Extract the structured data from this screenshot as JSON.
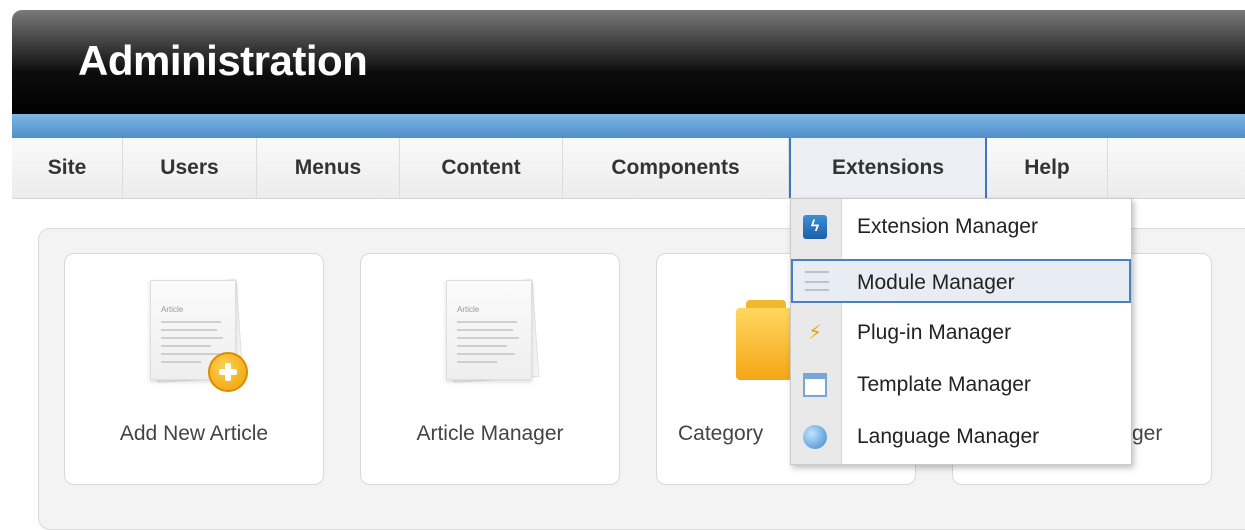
{
  "header": {
    "title": "Administration"
  },
  "menu": {
    "items": [
      {
        "label": "Site"
      },
      {
        "label": "Users"
      },
      {
        "label": "Menus"
      },
      {
        "label": "Content"
      },
      {
        "label": "Components"
      },
      {
        "label": "Extensions",
        "active": true
      },
      {
        "label": "Help"
      }
    ]
  },
  "cards": [
    {
      "label": "Add New Article",
      "icon": "add-article-icon"
    },
    {
      "label": "Article Manager",
      "icon": "article-icon"
    },
    {
      "label": "Category",
      "icon": "folder-icon"
    },
    {
      "label": "ger",
      "icon": "manager-icon"
    }
  ],
  "doc_icon_text": "Article",
  "dropdown": {
    "items": [
      {
        "label": "Extension Manager",
        "icon": "extension-icon"
      },
      {
        "label": "Module Manager",
        "icon": "module-icon",
        "highlighted": true
      },
      {
        "label": "Plug-in Manager",
        "icon": "plugin-icon"
      },
      {
        "label": "Template Manager",
        "icon": "template-icon"
      },
      {
        "label": "Language Manager",
        "icon": "globe-icon"
      }
    ]
  },
  "colors": {
    "accent_blue": "#4f8fcc",
    "highlight_border": "#4a7fc1",
    "icon_orange": "#f0a000"
  }
}
